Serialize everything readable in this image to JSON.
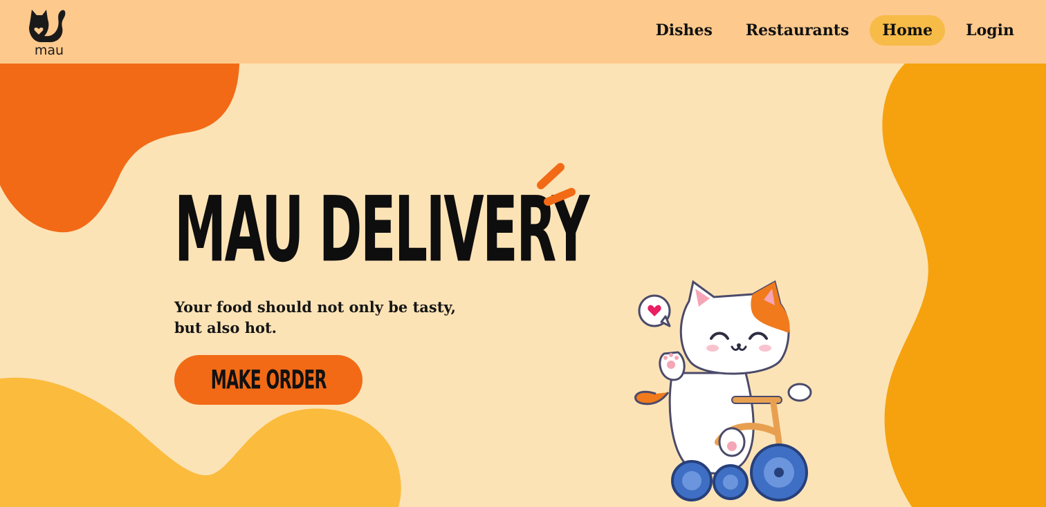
{
  "header": {
    "logo_text": "mau",
    "nav": [
      {
        "label": "Dishes",
        "active": false
      },
      {
        "label": "Restaurants",
        "active": false
      },
      {
        "label": "Home",
        "active": true
      },
      {
        "label": "Login",
        "active": false
      }
    ]
  },
  "hero": {
    "title": "MAU DELIVERY",
    "tagline_line1": "Your food should not only be tasty,",
    "tagline_line2": "but also hot.",
    "cta_label": "MAKE ORDER"
  },
  "illustration": {
    "icon": "cat-on-tricycle-illustration",
    "bubble_icon": "heart-icon"
  },
  "colors": {
    "background": "#fce3b6",
    "header": "#fec98c",
    "nav_active": "#f7bb48",
    "orange_blob": "#f26a16",
    "amber_blob": "#f6a20e",
    "yellow_blob": "#fbbb3c",
    "cta": "#f26a16",
    "text": "#111111"
  }
}
